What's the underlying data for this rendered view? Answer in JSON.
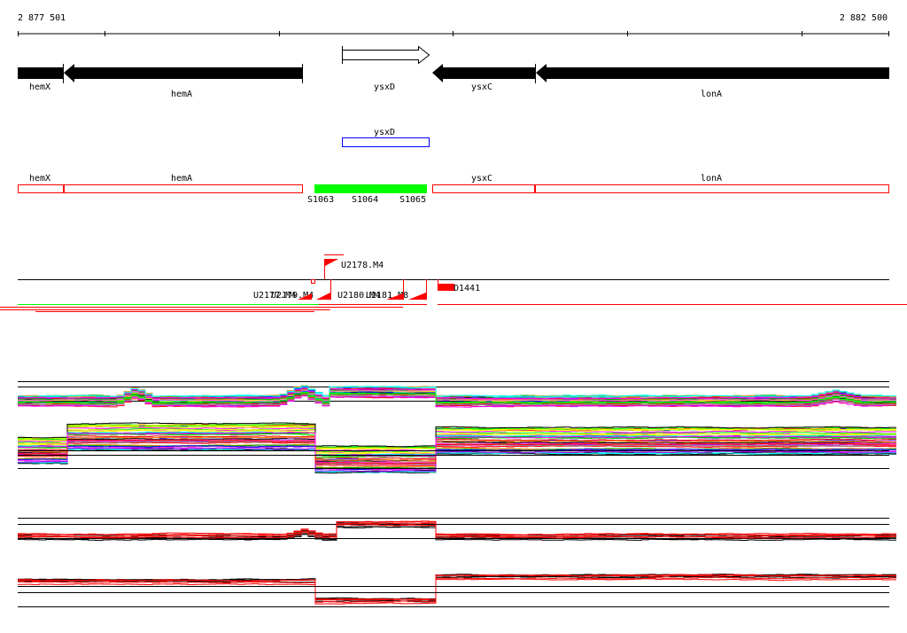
{
  "ruler": {
    "start_label": "2 877 501",
    "end_label": "2 882 500"
  },
  "genes": [
    {
      "name": "hemX",
      "strand": "-"
    },
    {
      "name": "hemA",
      "strand": "-"
    },
    {
      "name": "ysxD",
      "strand": "+"
    },
    {
      "name": "ysxC",
      "strand": "-"
    },
    {
      "name": "lonA",
      "strand": "-"
    }
  ],
  "annotation_box": {
    "label": "ysxD",
    "color": "#0000ff"
  },
  "segments": {
    "labels": [
      "hemX",
      "hemA",
      "ysxC",
      "lonA"
    ],
    "highlight_color": "#00ff00",
    "sites": [
      "S1063",
      "S1064",
      "S1065"
    ]
  },
  "features": {
    "upper": "U2178.M4",
    "lower": [
      "U2177.M4",
      "U2179.M4",
      "U2180.M4",
      "U2181.M8"
    ],
    "other": "D1441",
    "color": "#ff0000"
  },
  "colors": {
    "accent": "#ff0000",
    "box": "#0000ff",
    "green": "#00ff00"
  }
}
